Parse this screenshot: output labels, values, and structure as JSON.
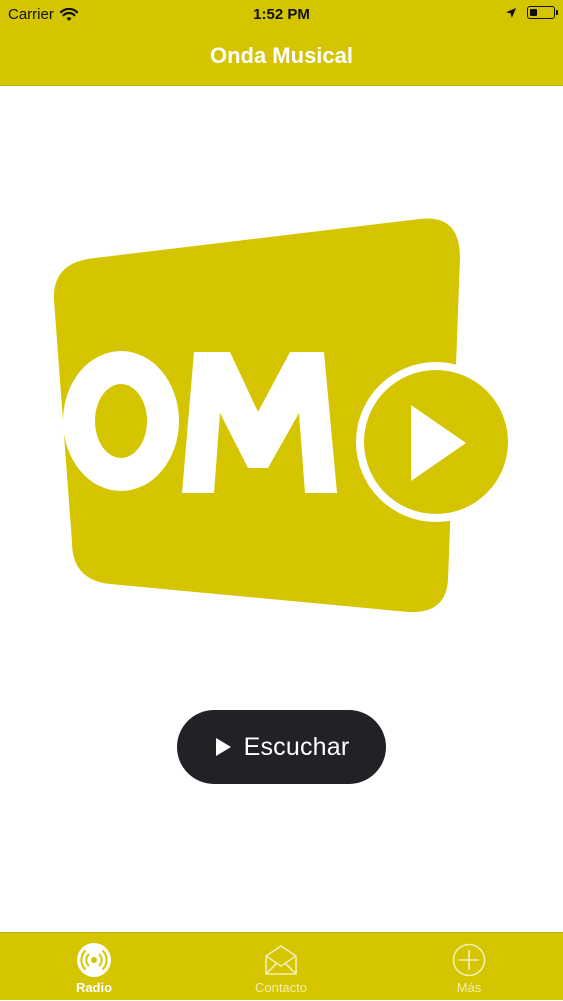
{
  "status_bar": {
    "carrier": "Carrier",
    "time": "1:52 PM",
    "icons": [
      "wifi-icon",
      "location-arrow-icon",
      "battery-icon"
    ]
  },
  "nav": {
    "title": "Onda Musical"
  },
  "logo": {
    "text": "OM",
    "icon": "play-circle-icon"
  },
  "main": {
    "listen_button": {
      "label": "Escuchar",
      "icon": "play-icon"
    }
  },
  "tabs": [
    {
      "label": "Radio",
      "icon": "radio-broadcast-icon",
      "active": true
    },
    {
      "label": "Contacto",
      "icon": "envelope-icon",
      "active": false
    },
    {
      "label": "Más",
      "icon": "plus-circle-icon",
      "active": false
    }
  ],
  "colors": {
    "brand": "#d4c500",
    "button_bg": "#222226",
    "white": "#ffffff"
  }
}
